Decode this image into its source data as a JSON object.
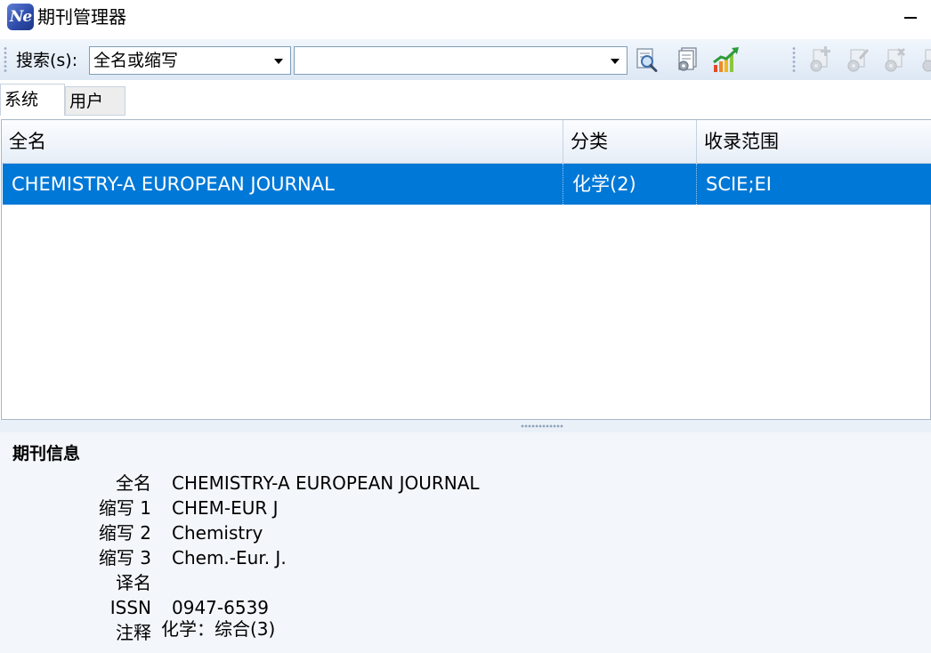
{
  "window": {
    "title": "期刊管理器",
    "icon_text": "Ne"
  },
  "toolbar": {
    "search_label": "搜索(s):",
    "search_field_value": "全名或缩写",
    "search_input_value": "",
    "buttons": [
      {
        "name": "search-icon",
        "enabled": true
      },
      {
        "name": "settings-document-icon",
        "enabled": true
      },
      {
        "name": "statistics-chart-icon",
        "enabled": true
      },
      {
        "name": "add-gear-icon",
        "enabled": false
      },
      {
        "name": "edit-gear-icon",
        "enabled": false
      },
      {
        "name": "delete-gear-icon",
        "enabled": false
      },
      {
        "name": "gear-icon",
        "enabled": false
      }
    ]
  },
  "tabs": [
    {
      "label": "系统",
      "active": true
    },
    {
      "label": "用户",
      "active": false
    }
  ],
  "grid": {
    "columns": [
      "全名",
      "分类",
      "收录范围"
    ],
    "rows": [
      {
        "full_name": "CHEMISTRY-A EUROPEAN JOURNAL",
        "category": "化学(2)",
        "coverage": "SCIE;EI",
        "selected": true
      }
    ]
  },
  "info": {
    "heading": "期刊信息",
    "fields": [
      {
        "label": "全名",
        "value": "CHEMISTRY-A EUROPEAN JOURNAL"
      },
      {
        "label": "缩写 1",
        "value": "CHEM-EUR J"
      },
      {
        "label": "缩写 2",
        "value": "Chemistry"
      },
      {
        "label": "缩写 3",
        "value": "Chem.-Eur. J."
      },
      {
        "label": "译名",
        "value": ""
      },
      {
        "label": "ISSN",
        "value": "0947-6539"
      },
      {
        "label": "注释",
        "value": "化学：综合(3)"
      }
    ]
  }
}
